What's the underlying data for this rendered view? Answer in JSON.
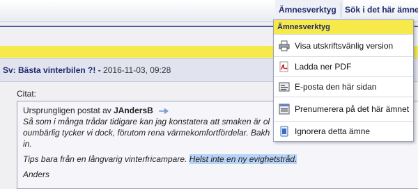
{
  "nav": {
    "tools_label": "Ämnesverktyg",
    "search_label": "Sök i det här ämnet"
  },
  "post": {
    "title": "Sv: Bästa vinterbilen ?! -",
    "date": "2016-11-03, 09:28",
    "citat_label": "Citat:",
    "quote": {
      "intro": "Ursprungligen postat av",
      "author": "JAndersB",
      "line1": "Så som i många trådar tidigare kan jag konstatera att smaken är ol",
      "line2": "oumbärlig tycker vi dock, förutom rena värmekomfortfördelar. Bakh",
      "line3": "in.",
      "line4a": "Tips bara från en långvarig vinterfricampare. ",
      "line4b": "Helst inte en ny evighetstråd.",
      "line5": "Anders"
    }
  },
  "menu": {
    "header": "Ämnesverktyg",
    "items": [
      {
        "label": "Visa utskriftsvänlig version",
        "icon": "printer-icon"
      },
      {
        "label": "Ladda ner PDF",
        "icon": "pdf-icon"
      },
      {
        "label": "E-posta den här sidan",
        "icon": "email-icon"
      },
      {
        "label": "Prenumerera på det här ämnet",
        "icon": "subscribe-icon"
      },
      {
        "label": "Ignorera detta ämne",
        "icon": "ignore-icon"
      }
    ]
  },
  "colors": {
    "accent_yellow": "#f7e94a",
    "nav_text": "#1f2a6b",
    "highlight": "#b7d3f5"
  }
}
